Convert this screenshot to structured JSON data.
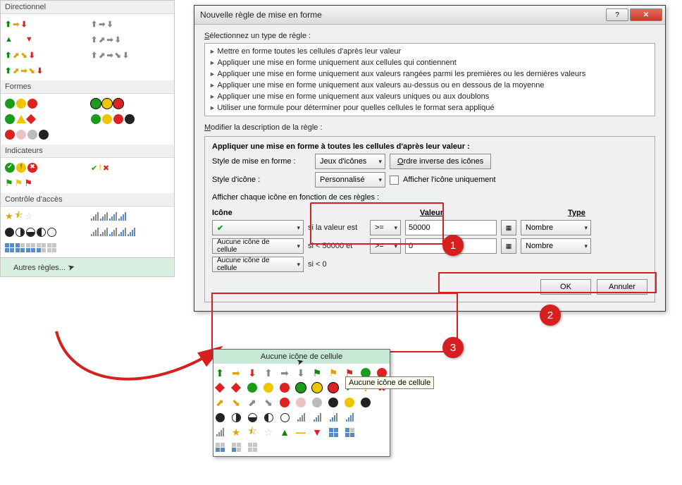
{
  "iconset_panel": {
    "headers": {
      "directionnel": "Directionnel",
      "formes": "Formes",
      "indicateurs": "Indicateurs",
      "controle": "Contrôle d'accès"
    },
    "autres_regles": "Autres règles..."
  },
  "dialog": {
    "title": "Nouvelle règle de mise en forme",
    "select_rule_label": "Sélectionnez un type de règle :",
    "rules": [
      "Mettre en forme toutes les cellules d'après leur valeur",
      "Appliquer une mise en forme uniquement aux cellules qui contiennent",
      "Appliquer une mise en forme uniquement aux valeurs rangées parmi les premières ou les dernières valeurs",
      "Appliquer une mise en forme uniquement aux valeurs au-dessus ou en dessous de la moyenne",
      "Appliquer une mise en forme uniquement aux valeurs uniques ou aux doublons",
      "Utiliser une formule pour déterminer pour quelles cellules le format sera appliqué"
    ],
    "modify_label": "Modifier la description de la règle :",
    "apply_bold": "Appliquer une mise en forme à toutes les cellules d'après leur valeur :",
    "style_mise_label": "Style de mise en forme :",
    "style_mise_value": "Jeux d'icônes",
    "reverse_btn": "Ordre inverse des icônes",
    "style_icone_label": "Style d'icône :",
    "style_icone_value": "Personnalisé",
    "show_icon_only": "Afficher l'icône uniquement",
    "afficher_regles": "Afficher chaque icône en fonction de ces règles :",
    "col_icone": "Icône",
    "col_valeur": "Valeur",
    "col_type": "Type",
    "rows": [
      {
        "icon": "green-check",
        "icon_label": "",
        "cond": "si la valeur est",
        "op": ">=",
        "value": "50000",
        "type": "Nombre"
      },
      {
        "icon": "none",
        "icon_label": "Aucune icône de cellule",
        "cond": "si < 50000 et",
        "op": ">=",
        "value": "0",
        "type": "Nombre"
      },
      {
        "icon": "none",
        "icon_label": "Aucune icône de cellule",
        "cond": "si < 0",
        "op": "",
        "value": "",
        "type": ""
      }
    ],
    "ok": "OK",
    "cancel": "Annuler"
  },
  "icon_popup": {
    "head": "Aucune icône de cellule",
    "tooltip": "Aucune icône de cellule"
  },
  "badges": {
    "b1": "1",
    "b2": "2",
    "b3": "3"
  }
}
